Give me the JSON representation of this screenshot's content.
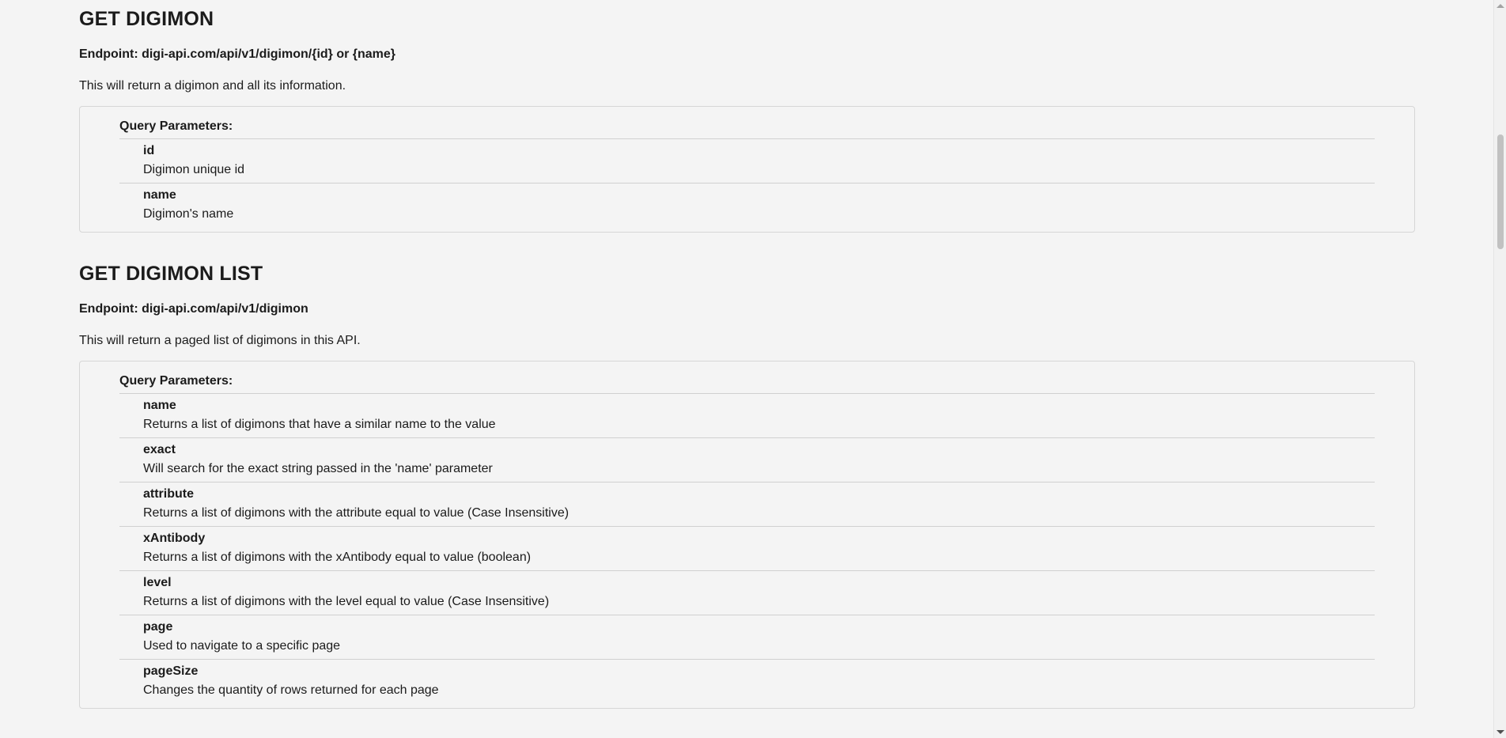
{
  "sections": [
    {
      "title": "GET DIGIMON",
      "endpoint": "Endpoint: digi-api.com/api/v1/digimon/{id} or {name}",
      "description": "This will return a digimon and all its information.",
      "params_title": "Query Parameters:",
      "params": [
        {
          "name": "id",
          "desc": "Digimon unique id"
        },
        {
          "name": "name",
          "desc": "Digimon's name"
        }
      ]
    },
    {
      "title": "GET DIGIMON LIST",
      "endpoint": "Endpoint: digi-api.com/api/v1/digimon",
      "description": "This will return a paged list of digimons in this API.",
      "params_title": "Query Parameters:",
      "params": [
        {
          "name": "name",
          "desc": "Returns a list of digimons that have a similar name to the value"
        },
        {
          "name": "exact",
          "desc": "Will search for the exact string passed in the 'name' parameter"
        },
        {
          "name": "attribute",
          "desc": "Returns a list of digimons with the attribute equal to value (Case Insensitive)"
        },
        {
          "name": "xAntibody",
          "desc": "Returns a list of digimons with the xAntibody equal to value (boolean)"
        },
        {
          "name": "level",
          "desc": "Returns a list of digimons with the level equal to value (Case Insensitive)"
        },
        {
          "name": "page",
          "desc": "Used to navigate to a specific page"
        },
        {
          "name": "pageSize",
          "desc": "Changes the quantity of rows returned for each page"
        }
      ]
    }
  ],
  "scrollbar": {
    "up_icon": "chevron-up-icon",
    "down_icon": "chevron-down-icon"
  }
}
